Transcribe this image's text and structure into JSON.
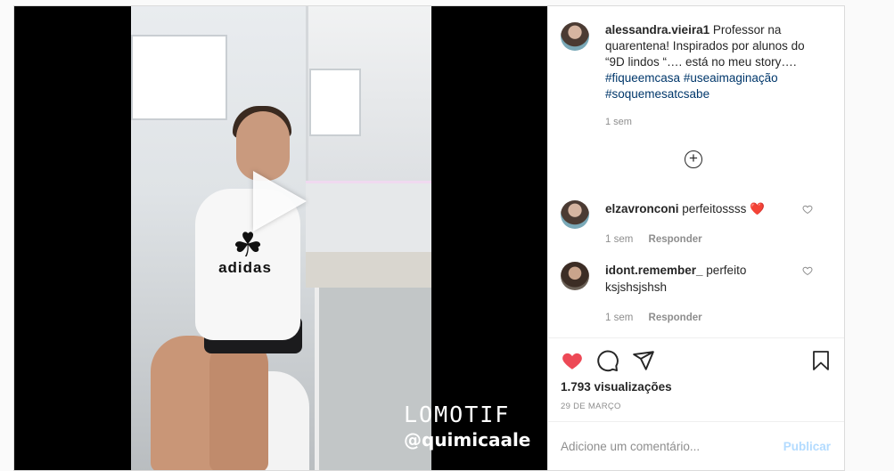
{
  "post": {
    "author": "alessandra.vieira1",
    "caption_text": "Professor na quarentena! Inspirados por alunos do “9D lindos “…. está no meu story….",
    "hashtags": [
      "#fiqueemcasa",
      "#useaimaginação",
      "#soquemesatcsabe"
    ],
    "time": "1 sem"
  },
  "video": {
    "shirt_brand": "adidas",
    "watermark_app": "LOMOTIF",
    "watermark_user": "@quimicaale"
  },
  "comments": [
    {
      "user": "elzavronconi",
      "text": "perfeitossss",
      "emoji": "❤️",
      "time": "1 sem",
      "reply_label": "Responder"
    },
    {
      "user": "idont.remember_",
      "text": "perfeito ksjshsjshsh",
      "time": "1 sem",
      "reply_label": "Responder"
    }
  ],
  "stats": {
    "views": "1.793 visualizações",
    "date": "29 DE MARÇO"
  },
  "comment_box": {
    "placeholder": "Adicione um comentário...",
    "submit_label": "Publicar"
  },
  "colors": {
    "like_active": "#ed4956",
    "link": "#00376b",
    "muted": "#8e8e8e",
    "publish_disabled": "#b3dbff"
  }
}
